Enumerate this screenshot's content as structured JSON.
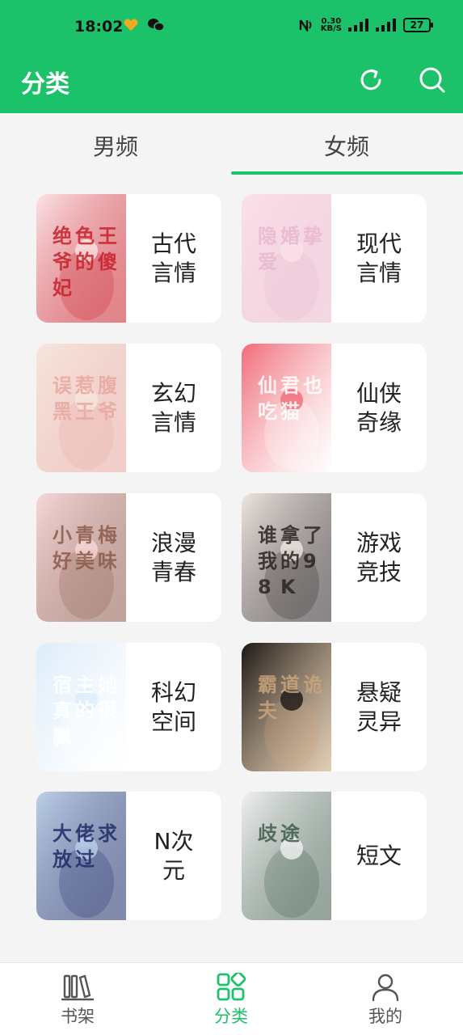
{
  "status_bar": {
    "time": "18:02",
    "net_speed_value": "0.30",
    "net_speed_unit": "KB/S",
    "battery": "27"
  },
  "app_bar": {
    "title": "分类",
    "refresh_icon": "refresh-icon",
    "search_icon": "search-icon"
  },
  "tabs": [
    {
      "label": "男频",
      "active": false
    },
    {
      "label": "女频",
      "active": true
    }
  ],
  "categories": [
    {
      "label": "古代言情",
      "cover_title": "绝色王爷的傻妃",
      "cover_colors": [
        "#fbe3e6",
        "#c8202a"
      ]
    },
    {
      "label": "现代言情",
      "cover_title": "隐婚挚爱",
      "cover_colors": [
        "#fbe0ea",
        "#e9b7cb"
      ]
    },
    {
      "label": "玄幻言情",
      "cover_title": "误惹腹黑王爷",
      "cover_colors": [
        "#f6e7df",
        "#e7a7a0"
      ]
    },
    {
      "label": "仙侠奇缘",
      "cover_title": "仙君也吃猫",
      "cover_colors": [
        "#f06b78",
        "#ffffff"
      ]
    },
    {
      "label": "浪漫青春",
      "cover_title": "小青梅好美味",
      "cover_colors": [
        "#f7d7d9",
        "#8b5a4a"
      ]
    },
    {
      "label": "游戏竞技",
      "cover_title": "谁拿了我的98K",
      "cover_colors": [
        "#efe6e0",
        "#2a2325"
      ]
    },
    {
      "label": "科幻空间",
      "cover_title": "宿主她真的很飘",
      "cover_colors": [
        "#dcecfa",
        "#ffffff"
      ]
    },
    {
      "label": "悬疑灵异",
      "cover_title": "霸道诡夫",
      "cover_colors": [
        "#1b1715",
        "#caa57a"
      ]
    },
    {
      "label": "N次元",
      "cover_title": "大佬求放过",
      "cover_colors": [
        "#bcd0e8",
        "#1d2a66"
      ]
    },
    {
      "label": "短文",
      "cover_title": "歧途",
      "cover_colors": [
        "#f1f1f1",
        "#3d5a4a"
      ]
    }
  ],
  "bottom_nav": [
    {
      "label": "书架",
      "icon": "bookshelf-icon",
      "active": false
    },
    {
      "label": "分类",
      "icon": "category-icon",
      "active": true
    },
    {
      "label": "我的",
      "icon": "profile-icon",
      "active": false
    }
  ],
  "colors": {
    "accent": "#1cc26a",
    "background": "#f4f4f4",
    "card": "#ffffff"
  }
}
